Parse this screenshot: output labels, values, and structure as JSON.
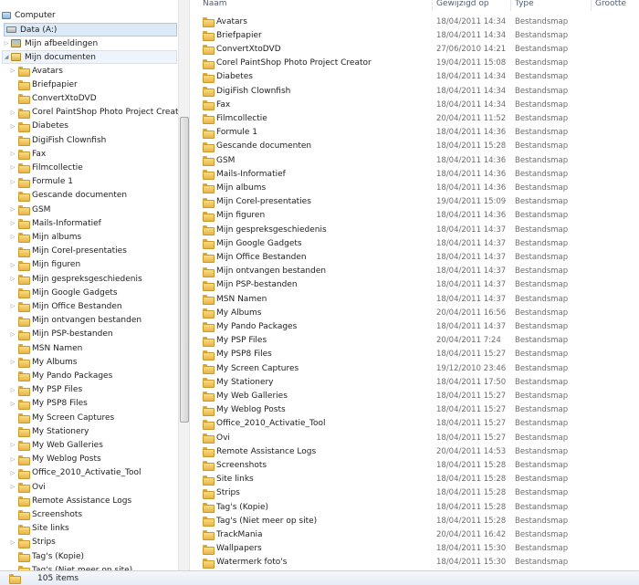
{
  "nav": {
    "computer": "Computer",
    "drive": "Data (A:)",
    "pictures": "Mijn afbeeldingen",
    "documents": "Mijn documenten",
    "folders": [
      {
        "label": "Avatars",
        "expand": true
      },
      {
        "label": "Briefpapier",
        "expand": false
      },
      {
        "label": "ConvertXtoDVD",
        "expand": false
      },
      {
        "label": "Corel PaintShop Photo Project Creator",
        "expand": true
      },
      {
        "label": "Diabetes",
        "expand": true
      },
      {
        "label": "DigiFish Clownfish",
        "expand": false
      },
      {
        "label": "Fax",
        "expand": true
      },
      {
        "label": "Filmcollectie",
        "expand": true
      },
      {
        "label": "Formule 1",
        "expand": true
      },
      {
        "label": "Gescande documenten",
        "expand": false
      },
      {
        "label": "GSM",
        "expand": true
      },
      {
        "label": "Mails-Informatief",
        "expand": true
      },
      {
        "label": "Mijn albums",
        "expand": true
      },
      {
        "label": "Mijn Corel-presentaties",
        "expand": false
      },
      {
        "label": "Mijn figuren",
        "expand": true
      },
      {
        "label": "Mijn gespreksgeschiedenis",
        "expand": true
      },
      {
        "label": "Mijn Google Gadgets",
        "expand": false
      },
      {
        "label": "Mijn Office Bestanden",
        "expand": true
      },
      {
        "label": "Mijn ontvangen bestanden",
        "expand": false
      },
      {
        "label": "Mijn PSP-bestanden",
        "expand": true
      },
      {
        "label": "MSN Namen",
        "expand": false
      },
      {
        "label": "My Albums",
        "expand": true
      },
      {
        "label": "My Pando Packages",
        "expand": false
      },
      {
        "label": "My PSP Files",
        "expand": true
      },
      {
        "label": "My PSP8 Files",
        "expand": true
      },
      {
        "label": "My Screen Captures",
        "expand": false
      },
      {
        "label": "My Stationery",
        "expand": false
      },
      {
        "label": "My Web Galleries",
        "expand": true
      },
      {
        "label": "My Weblog Posts",
        "expand": true
      },
      {
        "label": "Office_2010_Activatie_Tool",
        "expand": true
      },
      {
        "label": "Ovi",
        "expand": true
      },
      {
        "label": "Remote Assistance Logs",
        "expand": false
      },
      {
        "label": "Screenshots",
        "expand": false
      },
      {
        "label": "Site links",
        "expand": false
      },
      {
        "label": "Strips",
        "expand": true
      },
      {
        "label": "Tag's (Kopie)",
        "expand": false
      },
      {
        "label": "Tag's (Niet meer op site)",
        "expand": false
      }
    ]
  },
  "columns": {
    "name": "Naam",
    "date": "Gewijzigd op",
    "type": "Type",
    "size": "Grootte"
  },
  "files": [
    {
      "name": "Avatars",
      "date": "18/04/2011 14:34",
      "type": "Bestandsmap"
    },
    {
      "name": "Briefpapier",
      "date": "18/04/2011 14:34",
      "type": "Bestandsmap"
    },
    {
      "name": "ConvertXtoDVD",
      "date": "27/06/2010 14:21",
      "type": "Bestandsmap"
    },
    {
      "name": "Corel PaintShop Photo Project Creator",
      "date": "19/04/2011 15:08",
      "type": "Bestandsmap"
    },
    {
      "name": "Diabetes",
      "date": "18/04/2011 14:34",
      "type": "Bestandsmap"
    },
    {
      "name": "DigiFish Clownfish",
      "date": "18/04/2011 14:34",
      "type": "Bestandsmap"
    },
    {
      "name": "Fax",
      "date": "18/04/2011 14:34",
      "type": "Bestandsmap"
    },
    {
      "name": "Filmcollectie",
      "date": "20/04/2011 11:52",
      "type": "Bestandsmap"
    },
    {
      "name": "Formule 1",
      "date": "18/04/2011 14:36",
      "type": "Bestandsmap"
    },
    {
      "name": "Gescande documenten",
      "date": "18/04/2011 15:28",
      "type": "Bestandsmap"
    },
    {
      "name": "GSM",
      "date": "18/04/2011 14:36",
      "type": "Bestandsmap"
    },
    {
      "name": "Mails-Informatief",
      "date": "18/04/2011 14:36",
      "type": "Bestandsmap"
    },
    {
      "name": "Mijn albums",
      "date": "18/04/2011 14:36",
      "type": "Bestandsmap"
    },
    {
      "name": "Mijn Corel-presentaties",
      "date": "19/04/2011 15:09",
      "type": "Bestandsmap"
    },
    {
      "name": "Mijn figuren",
      "date": "18/04/2011 14:36",
      "type": "Bestandsmap"
    },
    {
      "name": "Mijn gespreksgeschiedenis",
      "date": "18/04/2011 14:37",
      "type": "Bestandsmap"
    },
    {
      "name": "Mijn Google Gadgets",
      "date": "18/04/2011 14:37",
      "type": "Bestandsmap"
    },
    {
      "name": "Mijn Office Bestanden",
      "date": "18/04/2011 14:37",
      "type": "Bestandsmap"
    },
    {
      "name": "Mijn ontvangen bestanden",
      "date": "18/04/2011 14:37",
      "type": "Bestandsmap"
    },
    {
      "name": "Mijn PSP-bestanden",
      "date": "18/04/2011 14:37",
      "type": "Bestandsmap"
    },
    {
      "name": "MSN Namen",
      "date": "18/04/2011 14:37",
      "type": "Bestandsmap"
    },
    {
      "name": "My Albums",
      "date": "20/04/2011 16:56",
      "type": "Bestandsmap"
    },
    {
      "name": "My Pando Packages",
      "date": "18/04/2011 14:37",
      "type": "Bestandsmap"
    },
    {
      "name": "My PSP Files",
      "date": "20/04/2011 7:24",
      "type": "Bestandsmap"
    },
    {
      "name": "My PSP8 Files",
      "date": "18/04/2011 15:27",
      "type": "Bestandsmap"
    },
    {
      "name": "My Screen Captures",
      "date": "19/12/2010 23:46",
      "type": "Bestandsmap"
    },
    {
      "name": "My Stationery",
      "date": "18/04/2011 17:50",
      "type": "Bestandsmap"
    },
    {
      "name": "My Web Galleries",
      "date": "18/04/2011 15:27",
      "type": "Bestandsmap"
    },
    {
      "name": "My Weblog Posts",
      "date": "18/04/2011 15:27",
      "type": "Bestandsmap"
    },
    {
      "name": "Office_2010_Activatie_Tool",
      "date": "18/04/2011 15:27",
      "type": "Bestandsmap"
    },
    {
      "name": "Ovi",
      "date": "18/04/2011 15:27",
      "type": "Bestandsmap"
    },
    {
      "name": "Remote Assistance Logs",
      "date": "20/04/2011 14:53",
      "type": "Bestandsmap"
    },
    {
      "name": "Screenshots",
      "date": "18/04/2011 15:28",
      "type": "Bestandsmap"
    },
    {
      "name": "Site links",
      "date": "18/04/2011 15:28",
      "type": "Bestandsmap"
    },
    {
      "name": "Strips",
      "date": "18/04/2011 15:28",
      "type": "Bestandsmap"
    },
    {
      "name": "Tag's (Kopie)",
      "date": "18/04/2011 15:28",
      "type": "Bestandsmap"
    },
    {
      "name": "Tag's (Niet meer op site)",
      "date": "18/04/2011 15:28",
      "type": "Bestandsmap"
    },
    {
      "name": "TrackMania",
      "date": "20/04/2011 16:42",
      "type": "Bestandsmap"
    },
    {
      "name": "Wallpapers",
      "date": "18/04/2011 15:30",
      "type": "Bestandsmap"
    },
    {
      "name": "Watermerk foto's",
      "date": "18/04/2011 15:30",
      "type": "Bestandsmap"
    }
  ],
  "status": {
    "count": "105 items"
  }
}
